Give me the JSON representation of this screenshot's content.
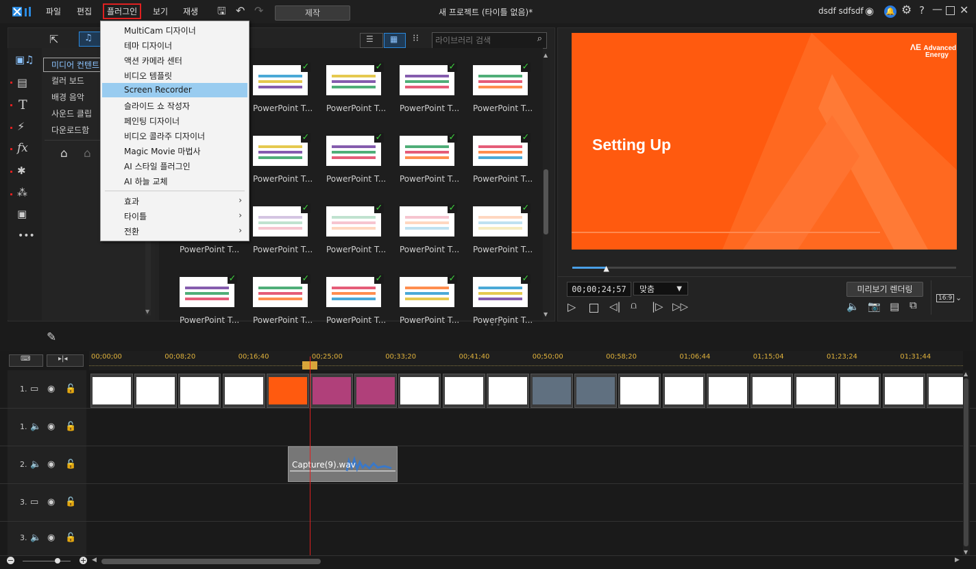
{
  "menubar": {
    "items": [
      "파일",
      "편집",
      "플러그인",
      "보기",
      "재생"
    ],
    "produce_label": "제작",
    "project_title": "새 프로젝트 (타이틀 없음)*",
    "user_name": "dsdf sdfsdf"
  },
  "plugin_menu": {
    "items": [
      "MultiCam 디자이너",
      "테마 디자이너",
      "액션 카메라 센터",
      "비디오 템플릿",
      "Screen Recorder",
      "슬라이드 쇼 작성자",
      "페인팅 디자이너",
      "비디오 콜라주 디자이너",
      "Magic Movie 마법사",
      "AI 스타일 플러그인",
      "AI 하늘 교체"
    ],
    "submenus": [
      "효과",
      "타이틀",
      "전환"
    ],
    "highlighted": "Screen Recorder"
  },
  "library": {
    "search_placeholder": "라이브러리 검색",
    "categories": [
      "미디어 컨텐트",
      "컬러 보드",
      "배경 음악",
      "사운드 클립",
      "다운로드함"
    ],
    "thumb_label": "PowerPoint T..."
  },
  "preview": {
    "slide_title": "Setting Up",
    "logo_line1": "Advanced",
    "logo_line2": "Energy",
    "timecode": "00;00;24;57",
    "fit_label": "맞춤",
    "render_label": "미리보기 렌더링",
    "aspect": "16:9",
    "progress": 0.09
  },
  "timeline": {
    "ticks": [
      "00;00;00",
      "00;08;20",
      "00;16;40",
      "00;25;00",
      "00;33;20",
      "00;41;40",
      "00;50;00",
      "00;58;20",
      "01;06;44",
      "01;15;04",
      "01;23;24",
      "01;31;44"
    ],
    "tracks": [
      "1.",
      "1.",
      "2.",
      "3.",
      "3."
    ],
    "audio_clip": "Capture(9).wav"
  },
  "colors": {
    "accent": "#ff5a0f",
    "highlight": "#99ccf0",
    "menu_outline": "#e02020"
  }
}
